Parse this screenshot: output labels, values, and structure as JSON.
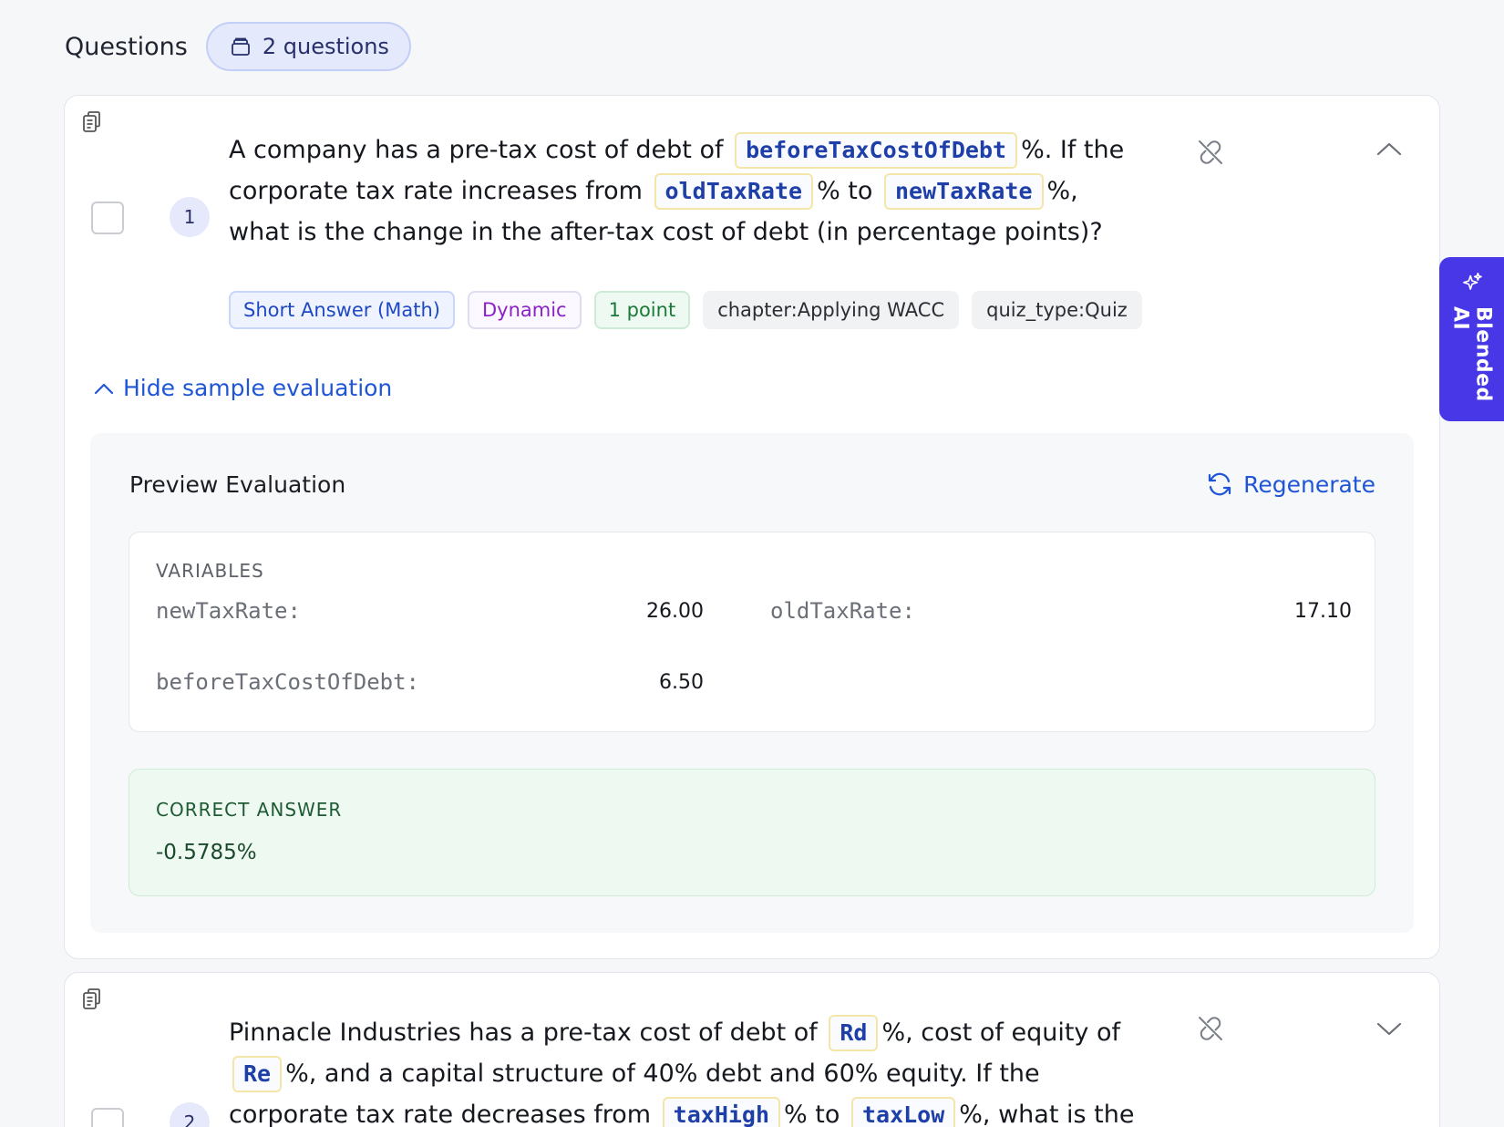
{
  "header": {
    "title": "Questions",
    "count_label": "2 questions"
  },
  "questions": [
    {
      "number": "1",
      "text_parts": {
        "p1": "A company has a pre-tax cost of debt of",
        "v1": "beforeTaxCostOfDebt",
        "p2": "%. If the corporate tax rate increases from",
        "v2": "oldTaxRate",
        "p3": "% to",
        "v3": "newTaxRate",
        "p4": "%, what is the change in the after-tax cost of debt (in percentage points)?"
      },
      "tags": {
        "type": "Short Answer (Math)",
        "mode": "Dynamic",
        "points": "1 point",
        "chapter": "chapter:Applying WACC",
        "quiz_type": "quiz_type:Quiz"
      },
      "toggle_label": "Hide sample evaluation",
      "evaluation": {
        "title": "Preview Evaluation",
        "regenerate_label": "Regenerate",
        "variables_label": "VARIABLES",
        "variables": [
          {
            "name": "newTaxRate:",
            "value": "26.00"
          },
          {
            "name": "oldTaxRate:",
            "value": "17.10"
          },
          {
            "name": "beforeTaxCostOfDebt:",
            "value": "6.50"
          }
        ],
        "correct_label": "CORRECT ANSWER",
        "correct_value": "-0.5785%"
      }
    },
    {
      "number": "2",
      "text_parts": {
        "p1": "Pinnacle Industries has a pre-tax cost of debt of",
        "v1": "Rd",
        "p2": "%, cost of equity of",
        "v2": "Re",
        "p3": "%, and a capital structure of 40% debt and 60% equity. If the corporate tax rate decreases from",
        "v3": "taxHigh",
        "p4": "% to",
        "v4": "taxLow",
        "p5": "%, what is the change in the"
      }
    }
  ],
  "side_tab": {
    "label": "Blended AI",
    "icon": "sparkles-icon"
  },
  "colors": {
    "accent": "#1f55d6",
    "side_tab": "#4737e6",
    "variable_text": "#1e3fa8",
    "correct_bg": "#eefaf1"
  }
}
